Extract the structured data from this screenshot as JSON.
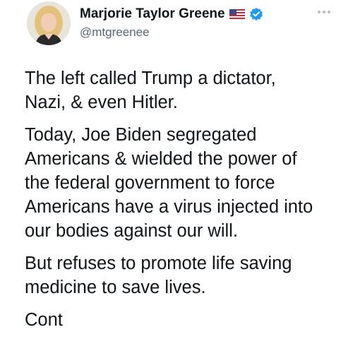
{
  "tweet": {
    "display_name": "Marjorie Taylor Greene",
    "handle": "@mtgreenee",
    "icons": {
      "flag": "us-flag-icon",
      "verified": "verified-badge-icon",
      "more": "more-options-icon"
    },
    "colors": {
      "text": "#0f1419",
      "secondary": "#536471",
      "verified": "#1d9bf0"
    },
    "paragraphs": [
      {
        "lines": [
          "The left called Trump a dictator,",
          "Nazi, & even Hitler."
        ]
      },
      {
        "lines": [
          "Today, Joe Biden segregated",
          "Americans & wielded the power of",
          "the federal government to force",
          "Americans have a virus injected into",
          "our bodies against our will."
        ]
      },
      {
        "lines": [
          "But refuses to promote life saving",
          "medicine to save lives."
        ]
      },
      {
        "lines": [
          "Cont"
        ]
      }
    ]
  }
}
